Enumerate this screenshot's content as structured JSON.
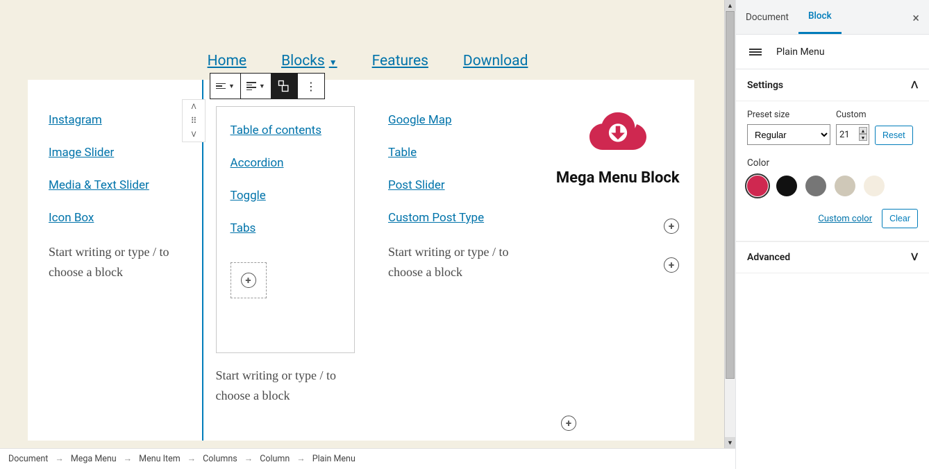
{
  "nav": {
    "home": "Home",
    "blocks": "Blocks",
    "features": "Features",
    "download": "Download"
  },
  "columns": {
    "col1": {
      "links": [
        "Instagram",
        "Image Slider",
        "Media & Text Slider",
        "Icon Box"
      ],
      "placeholder": "Start writing or type / to choose a block"
    },
    "col2": {
      "links": [
        "Table of contents",
        "Accordion",
        "Toggle",
        "Tabs"
      ],
      "placeholder": "Start writing or type / to choose a block"
    },
    "col3": {
      "links": [
        "Google Map",
        "Table",
        "Post Slider",
        "Custom Post Type"
      ],
      "placeholder": "Start writing or type / to choose a block"
    },
    "col4": {
      "title": "Mega Menu Block"
    }
  },
  "breadcrumb": [
    "Document",
    "Mega Menu",
    "Menu Item",
    "Columns",
    "Column",
    "Plain Menu"
  ],
  "sidebar": {
    "tabs": {
      "document": "Document",
      "block": "Block"
    },
    "block_name": "Plain Menu",
    "panels": {
      "settings": {
        "title": "Settings",
        "preset_label": "Preset size",
        "preset_value": "Regular",
        "custom_label": "Custom",
        "custom_value": "21",
        "reset": "Reset",
        "color_label": "Color",
        "colors": [
          "#cf2850",
          "#111111",
          "#767676",
          "#cfc8b8",
          "#f4ede0"
        ],
        "custom_color": "Custom color",
        "clear": "Clear"
      },
      "advanced": {
        "title": "Advanced"
      }
    }
  }
}
